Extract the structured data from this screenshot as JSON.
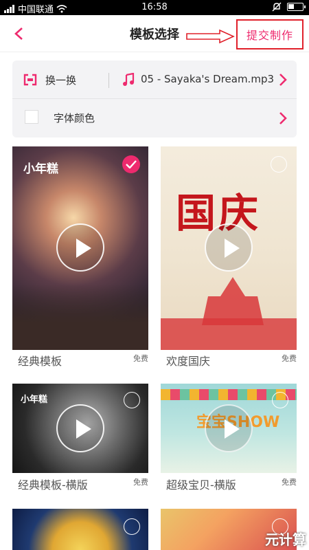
{
  "status_bar": {
    "carrier": "中国联通",
    "time": "16:58"
  },
  "nav": {
    "title": "模板选择",
    "submit_label": "提交制作"
  },
  "options": {
    "switch_label": "换一换",
    "music_label": "05 - Sayaka's Dream.mp3",
    "font_color_label": "字体颜色"
  },
  "templates": [
    {
      "title": "经典模板",
      "price": "免费",
      "selected": true,
      "thumb_text": "小年糕"
    },
    {
      "title": "欢度国庆",
      "price": "免费",
      "selected": false,
      "thumb_text": "国庆"
    },
    {
      "title": "经典模板-横版",
      "price": "免费",
      "selected": false,
      "thumb_text": "小年糕"
    },
    {
      "title": "超级宝贝-横版",
      "price": "免费",
      "selected": false,
      "thumb_text": "宝宝SHOW"
    }
  ],
  "watermark": "元计算",
  "colors": {
    "accent": "#ee2a6e",
    "annotation": "#e0202a"
  }
}
